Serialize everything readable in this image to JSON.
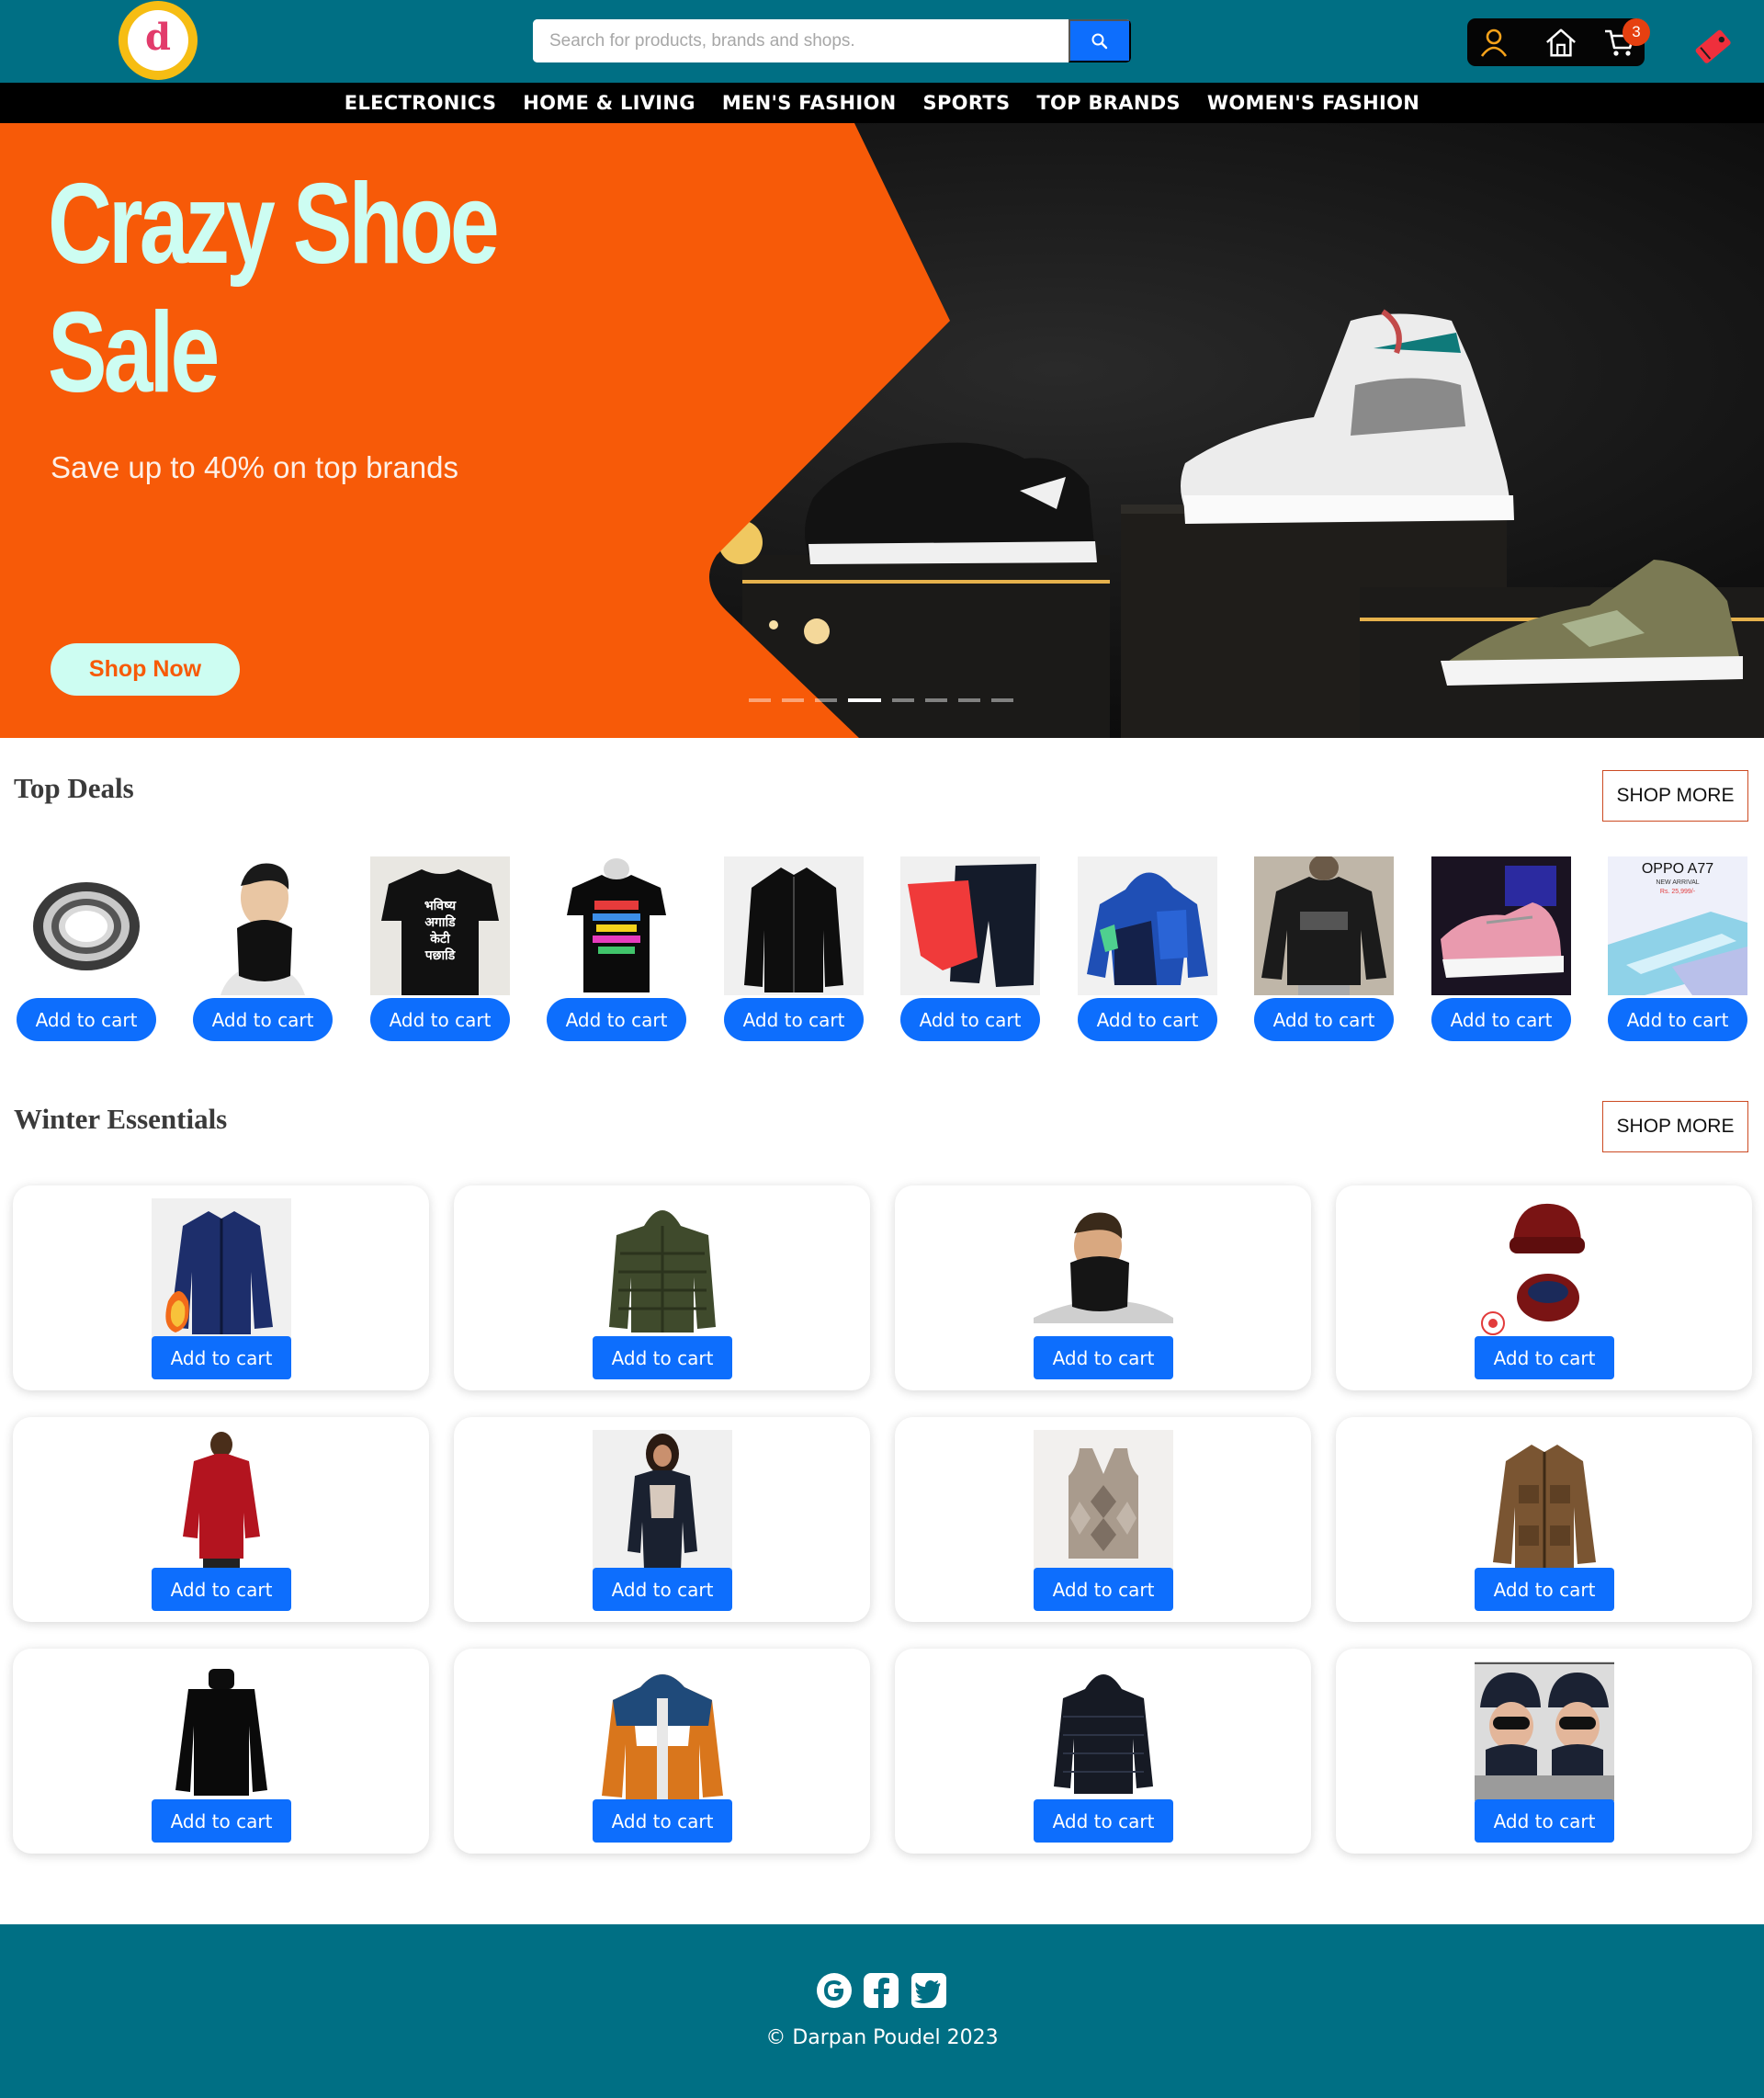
{
  "header": {
    "logo_letter": "d",
    "search_placeholder": "Search for products, brands and shops.",
    "cart_count": "3"
  },
  "nav": [
    "ELECTRONICS",
    "HOME & LIVING",
    "MEN'S FASHION",
    "SPORTS",
    "TOP BRANDS",
    "WOMEN'S FASHION"
  ],
  "hero": {
    "title_line1": "Crazy Shoe",
    "title_line2": "Sale",
    "subtitle": "Save up to 40% on top brands",
    "cta": "Shop Now",
    "slide_count": 8,
    "active_slide": 4
  },
  "top_deals": {
    "title": "Top Deals",
    "shop_more": "SHOP MORE",
    "add_label": "Add to cart",
    "items": [
      {
        "icon": "bearing-icon"
      },
      {
        "icon": "neck-warmer-icon"
      },
      {
        "icon": "tshirt-icon",
        "print_line1": "भविष्य",
        "print_line2": "अगाडि",
        "print_line3": "केटी",
        "print_line4": "पछाडि"
      },
      {
        "icon": "tshirt-icon"
      },
      {
        "icon": "leather-jacket-icon"
      },
      {
        "icon": "shorts-icon"
      },
      {
        "icon": "hoodie-icon"
      },
      {
        "icon": "sweatshirt-icon"
      },
      {
        "icon": "sneaker-icon"
      },
      {
        "icon": "phone-icon",
        "brand": "OPPO A77",
        "tagline": "NEW ARRIVAL",
        "price": "Rs. 25,999/-"
      }
    ]
  },
  "winter": {
    "title": "Winter Essentials",
    "shop_more": "SHOP MORE",
    "add_label": "Add to cart",
    "items": [
      {
        "icon": "fleece-jacket-icon"
      },
      {
        "icon": "puffer-jacket-icon"
      },
      {
        "icon": "neck-warmer-icon"
      },
      {
        "icon": "beanie-scarf-icon"
      },
      {
        "icon": "red-jacket-icon"
      },
      {
        "icon": "denim-jacket-icon"
      },
      {
        "icon": "sweater-vest-icon"
      },
      {
        "icon": "cargo-jacket-icon"
      },
      {
        "icon": "turtleneck-icon"
      },
      {
        "icon": "windbreaker-icon"
      },
      {
        "icon": "puffer-jacket-icon"
      },
      {
        "icon": "beanie-scarf-icon"
      }
    ]
  },
  "footer": {
    "social": [
      "google-icon",
      "facebook-icon",
      "twitter-icon"
    ],
    "copyright": "© Darpan Poudel 2023"
  },
  "colors": {
    "header_bg": "#006f84",
    "primary_button": "#0d6efd",
    "hero_orange": "#f75a08",
    "hero_text": "#cdfdf2",
    "shop_more_border": "#cc4b23"
  }
}
